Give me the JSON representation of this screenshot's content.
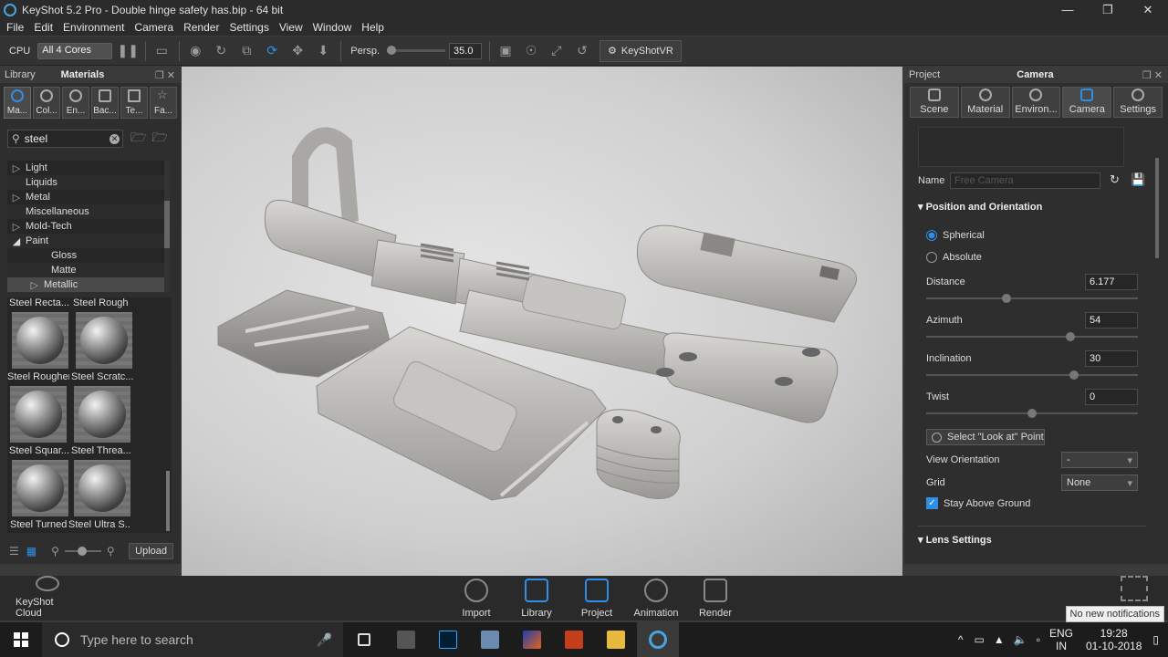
{
  "window": {
    "title": "KeyShot 5.2 Pro  - Double hinge safety has.bip  - 64 bit"
  },
  "menu": [
    "File",
    "Edit",
    "Environment",
    "Camera",
    "Render",
    "Settings",
    "View",
    "Window",
    "Help"
  ],
  "toolbar": {
    "cpu_label": "CPU",
    "cores_select": "All 4 Cores",
    "persp_label": "Persp.",
    "fov_value": "35.0",
    "vr_label": "KeyShotVR"
  },
  "library": {
    "tab_library": "Library",
    "tab_materials": "Materials",
    "cat_tabs": [
      "Ma...",
      "Col...",
      "En...",
      "Bac...",
      "Te...",
      "Fa..."
    ],
    "search_value": "steel",
    "tree": [
      "Light",
      "Liquids",
      "Metal",
      "Miscellaneous",
      "Mold-Tech",
      "Paint",
      "Gloss",
      "Matte",
      "Metallic"
    ],
    "thumbs": [
      "Steel Recta...",
      "Steel Rough",
      "Steel Rougher",
      "Steel Scratc...",
      "Steel Squar...",
      "Steel Threa...",
      "Steel Turned",
      "Steel Ultra S..."
    ],
    "upload_label": "Upload"
  },
  "project": {
    "tab_project": "Project",
    "tab_camera": "Camera",
    "tabs": [
      "Scene",
      "Material",
      "Environ...",
      "Camera",
      "Settings"
    ],
    "name_label": "Name",
    "name_placeholder": "Free Camera",
    "pos_section": "Position and Orientation",
    "spherical_label": "Spherical",
    "absolute_label": "Absolute",
    "distance_label": "Distance",
    "distance_value": "6.177",
    "azimuth_label": "Azimuth",
    "azimuth_value": "54",
    "inclination_label": "Inclination",
    "inclination_value": "30",
    "twist_label": "Twist",
    "twist_value": "0",
    "look_at_label": "Select \"Look at\" Point",
    "view_orient_label": "View Orientation",
    "view_orient_value": "-",
    "grid_label": "Grid",
    "grid_value": "None",
    "stay_above_label": "Stay Above Ground",
    "lens_section": "Lens Settings"
  },
  "dock": {
    "cloud_label": "KeyShot Cloud",
    "items": [
      "Import",
      "Library",
      "Project",
      "Animation",
      "Render"
    ]
  },
  "notification": "No new notifications",
  "taskbar": {
    "search_placeholder": "Type here to search",
    "lang_top": "ENG",
    "lang_bottom": "IN",
    "time": "19:28",
    "date": "01-10-2018"
  }
}
